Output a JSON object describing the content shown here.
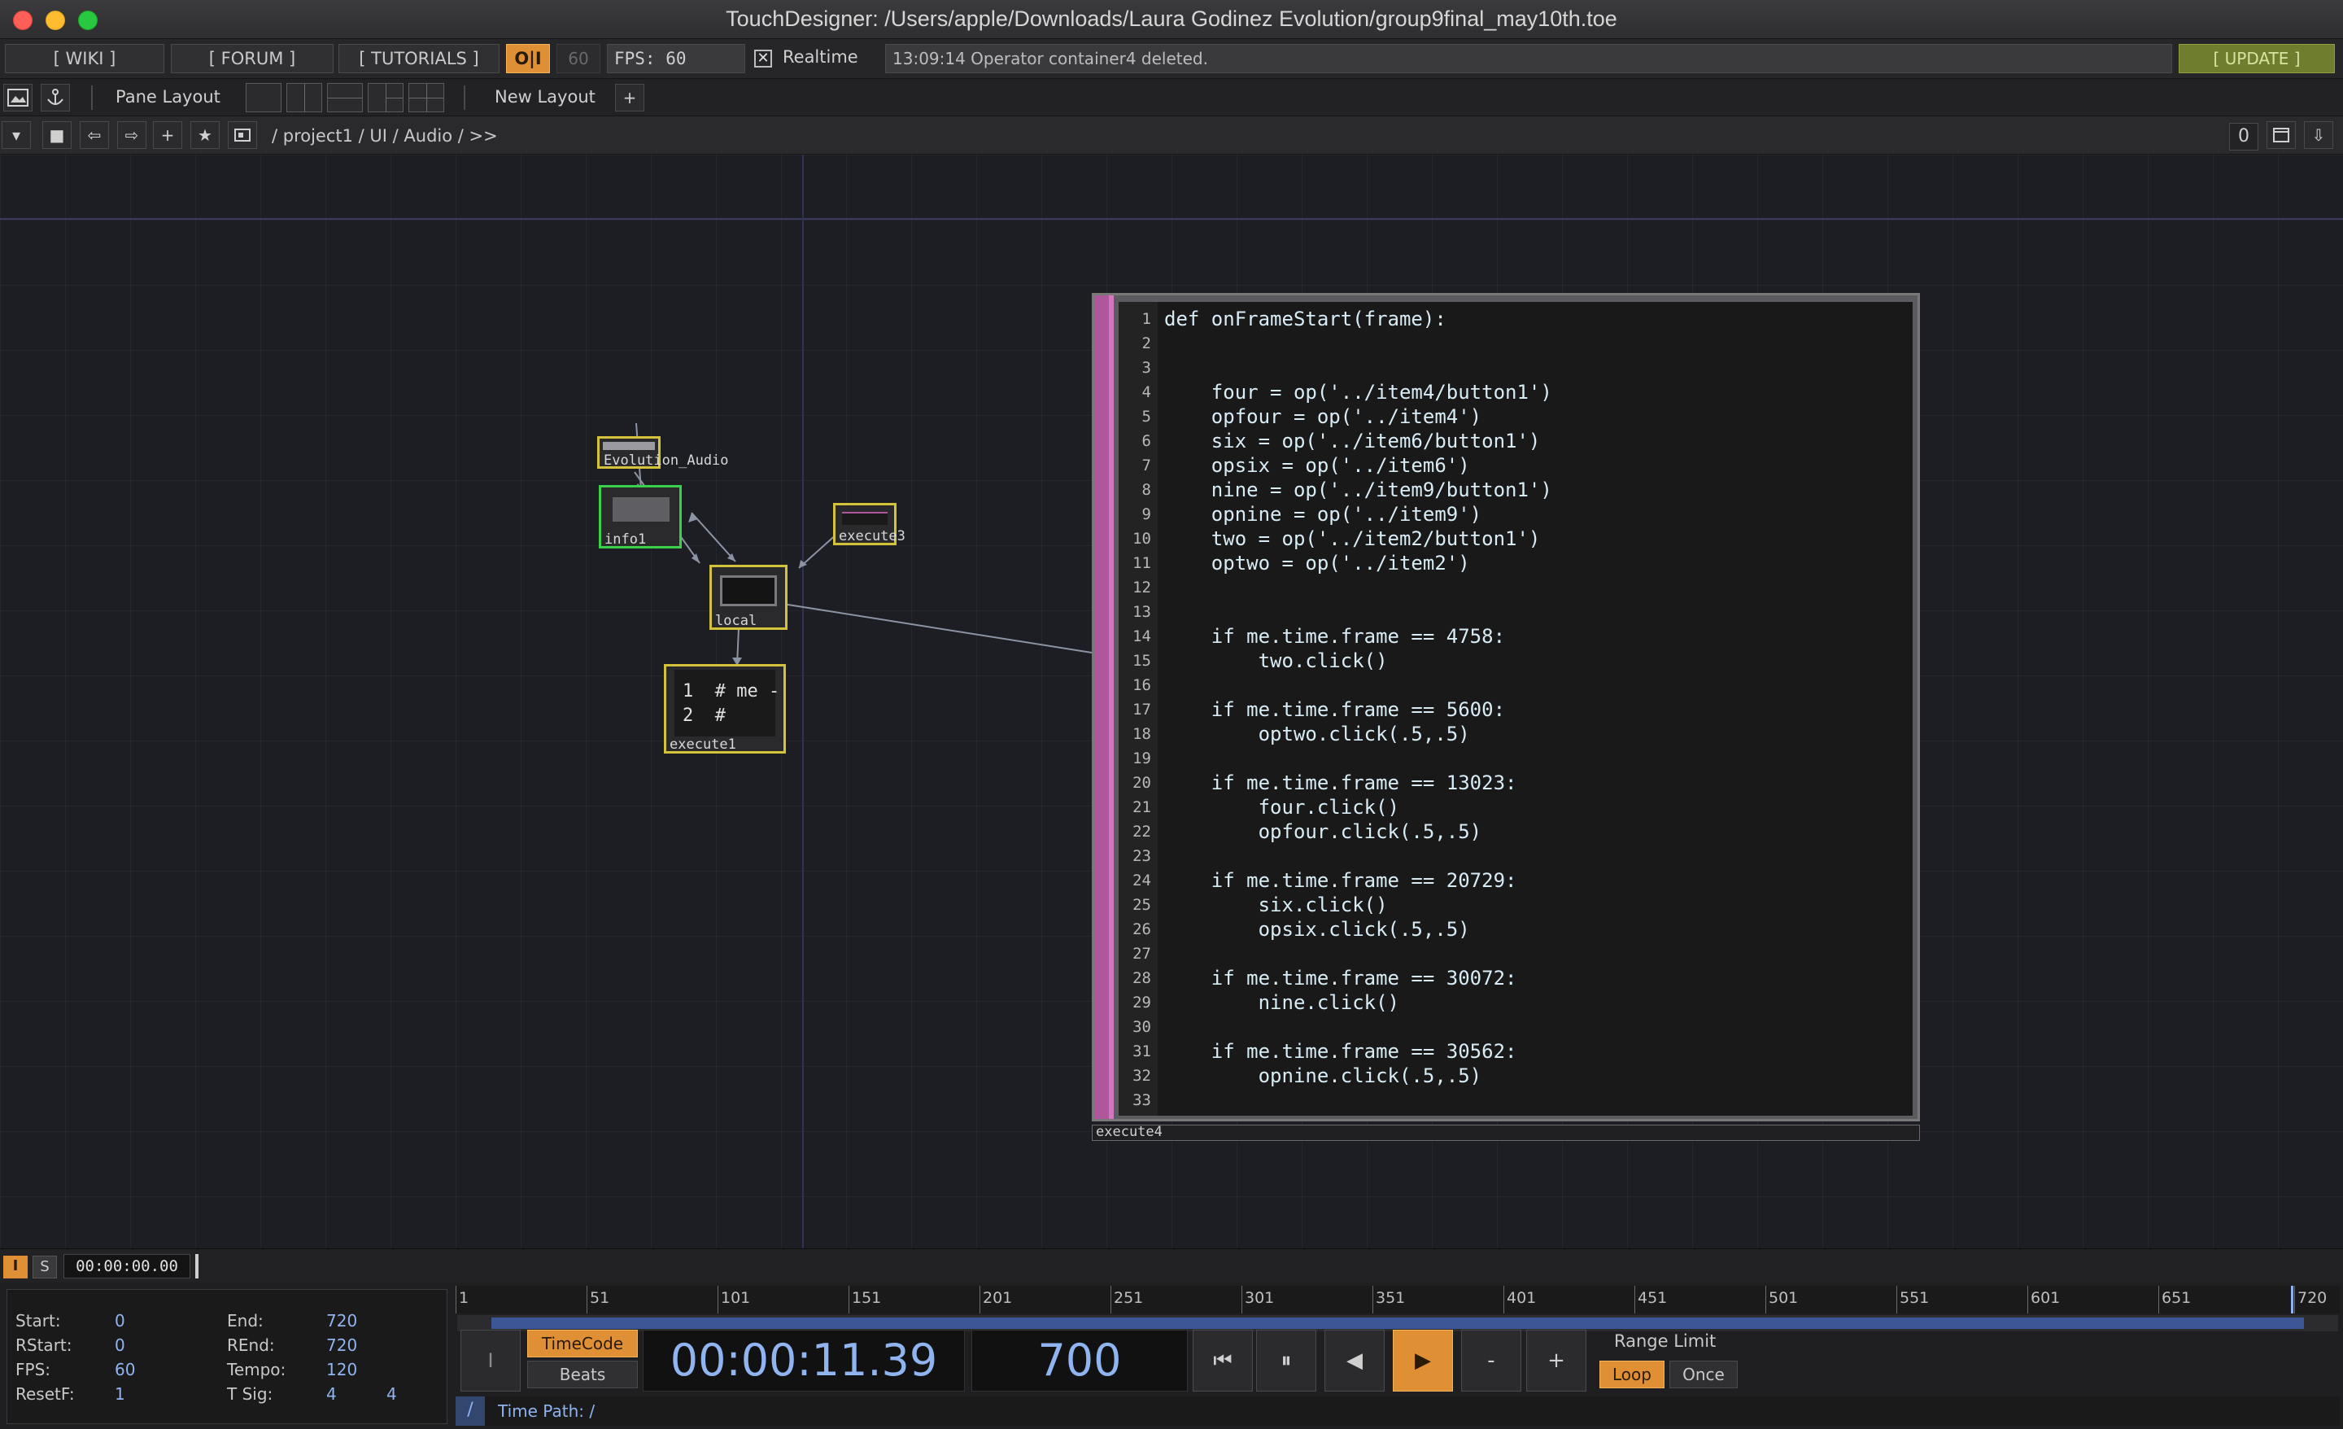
{
  "window": {
    "title": "TouchDesigner: /Users/apple/Downloads/Laura Godinez Evolution/group9final_may10th.toe"
  },
  "toolbar": {
    "wiki": "[ WIKI ]",
    "forum": "[ FORUM ]",
    "tutorials": "[ TUTORIALS ]",
    "oi": "O|I",
    "fps_cap": "60",
    "fps_label": "FPS:  60",
    "realtime_check": "✕",
    "realtime": "Realtime",
    "status": "13:09:14 Operator container4 deleted.",
    "update": "[ UPDATE ]"
  },
  "pane_toolbar": {
    "pane_layout": "Pane Layout",
    "new_layout": "New Layout",
    "add": "+"
  },
  "path_bar": {
    "path": "/  project1  /  UI  /  Audio  /  >>",
    "counter": "0"
  },
  "nodes": {
    "evolution_audio": "Evolution_Audio",
    "info": "info1",
    "execute3": "execute3",
    "local": "local",
    "execute1": "execute1",
    "execute1_preview": [
      "1  # me -",
      "2  #"
    ],
    "execute4": "execute4"
  },
  "code": {
    "lines": [
      {
        "n": "1",
        "t": "def onFrameStart(frame):"
      },
      {
        "n": "2",
        "t": ""
      },
      {
        "n": "3",
        "t": ""
      },
      {
        "n": "4",
        "t": "    four = op('../item4/button1')"
      },
      {
        "n": "5",
        "t": "    opfour = op('../item4')"
      },
      {
        "n": "6",
        "t": "    six = op('../item6/button1')"
      },
      {
        "n": "7",
        "t": "    opsix = op('../item6')"
      },
      {
        "n": "8",
        "t": "    nine = op('../item9/button1')"
      },
      {
        "n": "9",
        "t": "    opnine = op('../item9')"
      },
      {
        "n": "10",
        "t": "    two = op('../item2/button1')"
      },
      {
        "n": "11",
        "t": "    optwo = op('../item2')"
      },
      {
        "n": "12",
        "t": ""
      },
      {
        "n": "13",
        "t": ""
      },
      {
        "n": "14",
        "t": "    if me.time.frame == 4758:"
      },
      {
        "n": "15",
        "t": "        two.click()"
      },
      {
        "n": "16",
        "t": ""
      },
      {
        "n": "17",
        "t": "    if me.time.frame == 5600:"
      },
      {
        "n": "18",
        "t": "        optwo.click(.5,.5)"
      },
      {
        "n": "19",
        "t": ""
      },
      {
        "n": "20",
        "t": "    if me.time.frame == 13023:"
      },
      {
        "n": "21",
        "t": "        four.click()"
      },
      {
        "n": "22",
        "t": "        opfour.click(.5,.5)"
      },
      {
        "n": "23",
        "t": ""
      },
      {
        "n": "24",
        "t": "    if me.time.frame == 20729:"
      },
      {
        "n": "25",
        "t": "        six.click()"
      },
      {
        "n": "26",
        "t": "        opsix.click(.5,.5)"
      },
      {
        "n": "27",
        "t": ""
      },
      {
        "n": "28",
        "t": "    if me.time.frame == 30072:"
      },
      {
        "n": "29",
        "t": "        nine.click()"
      },
      {
        "n": "30",
        "t": ""
      },
      {
        "n": "31",
        "t": "    if me.time.frame == 30562:"
      },
      {
        "n": "32",
        "t": "        opnine.click(.5,.5)"
      },
      {
        "n": "33",
        "t": ""
      }
    ]
  },
  "timeline": {
    "i_btn": "I",
    "s_btn": "S",
    "mini_time": "00:00:00.00",
    "ruler_ticks": [
      "1",
      "51",
      "101",
      "151",
      "201",
      "251",
      "301",
      "351",
      "401",
      "451",
      "501",
      "551",
      "601",
      "651",
      "720"
    ],
    "range": {
      "start_label": "Start:",
      "start": "0",
      "end_label": "End:",
      "end": "720",
      "rstart_label": "RStart:",
      "rstart": "0",
      "rend_label": "REnd:",
      "rend": "720",
      "fps_label": "FPS:",
      "fps": "60",
      "tempo_label": "Tempo:",
      "tempo": "120",
      "resetf_label": "ResetF:",
      "resetf": "1",
      "tsig_label": "T Sig:",
      "tsig_a": "4",
      "tsig_b": "4"
    },
    "timecode_btn": "TimeCode",
    "beats_btn": "Beats",
    "timecode": "00:00:11.39",
    "frame": "700",
    "cursor_glyph": "I",
    "range_limit": "Range Limit",
    "loop": "Loop",
    "once": "Once",
    "time_path_slash": "/",
    "time_path": "Time Path: /",
    "playback": {
      "to_start": "⏮",
      "pause": "⏸",
      "step_back": "◀",
      "play": "▶",
      "minus": "-",
      "plus": "+"
    }
  },
  "icons": {
    "arrow_left": "⇦",
    "arrow_right": "⇨",
    "plus": "+",
    "star": "★",
    "stop": "■",
    "down": "▾",
    "download": "⇩"
  }
}
